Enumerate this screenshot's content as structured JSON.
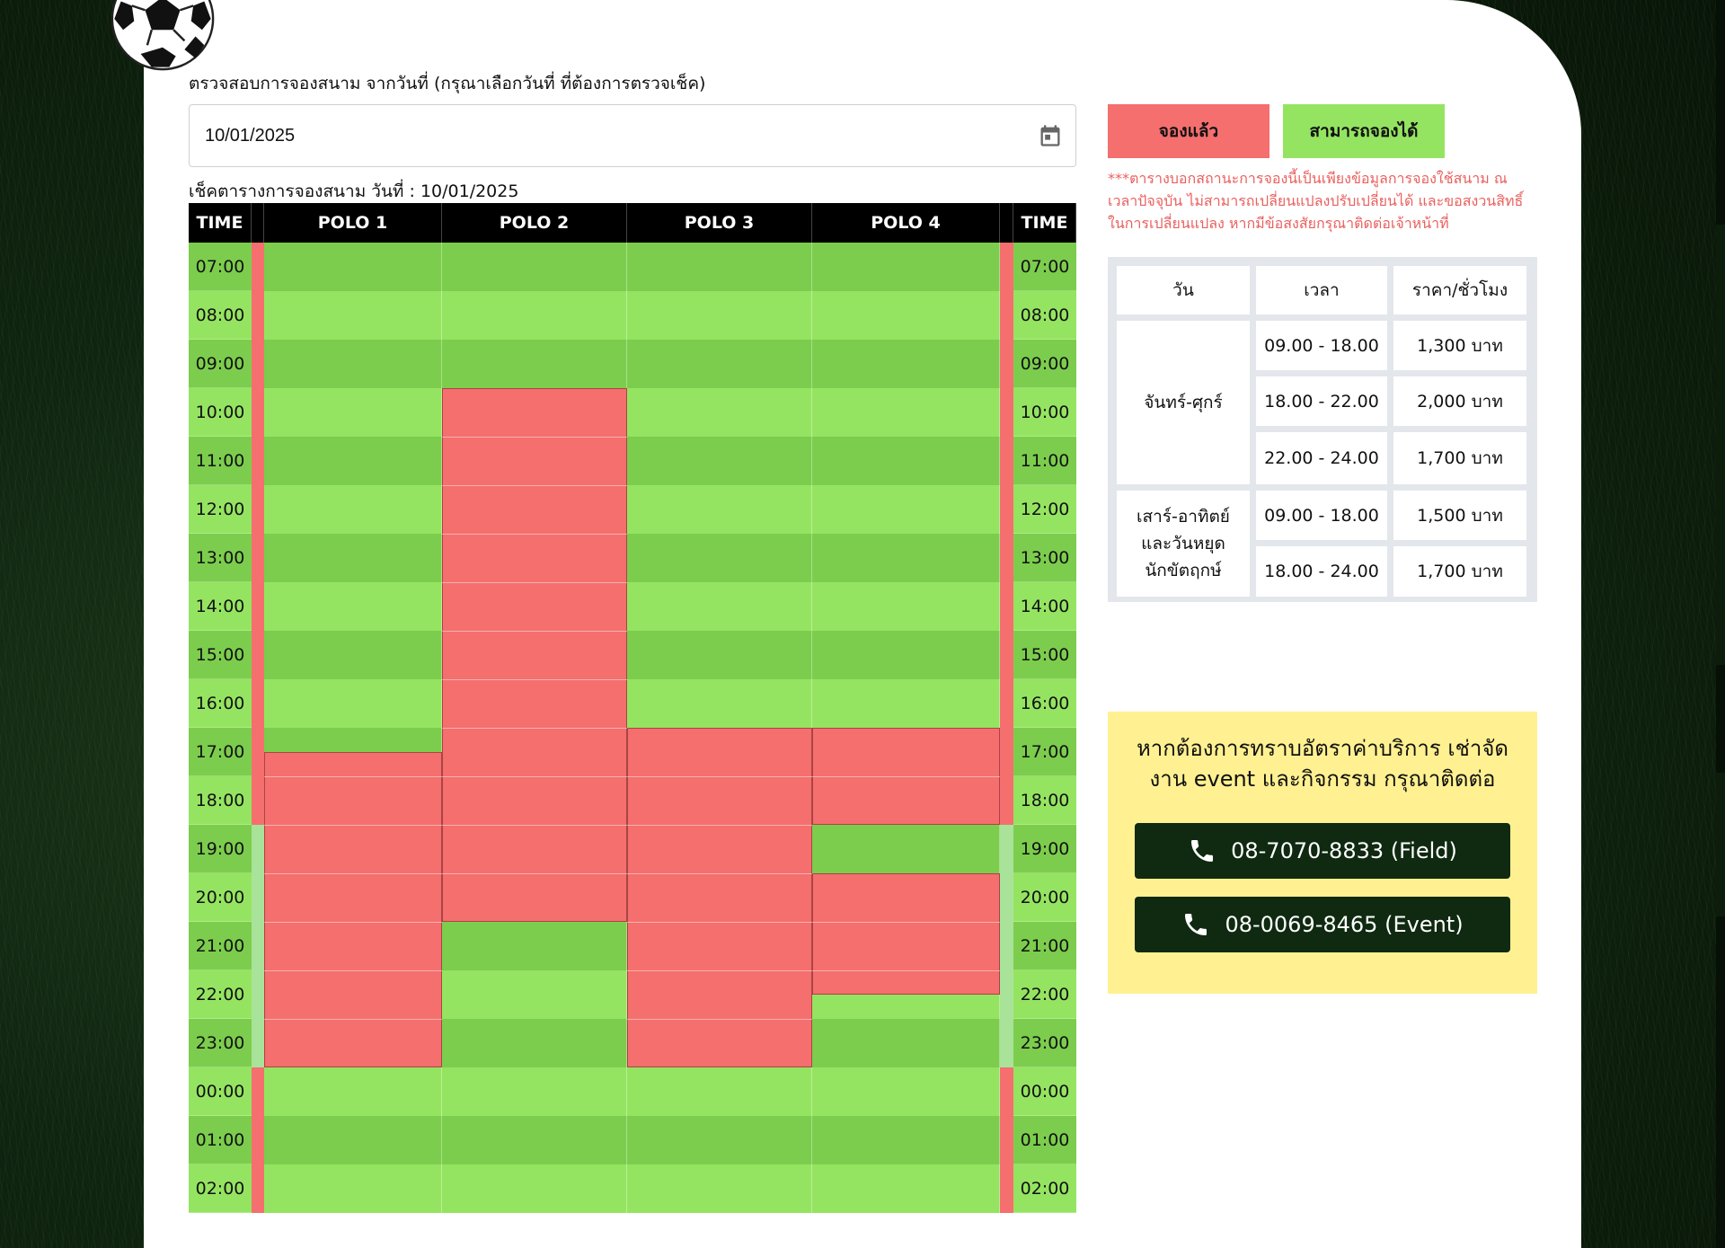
{
  "form": {
    "check_label": "ตรวจสอบการจองสนาม จากวันที่ (กรุณาเลือกวันที่ ที่ต้องการตรวจเช็ค)",
    "date_value": "10/01/2025",
    "calendar_icon": "calendar-icon"
  },
  "schedule": {
    "caption": "เช็คตารางการจองสนาม วันที่ : 10/01/2025",
    "time_header": "TIME",
    "fields": [
      "POLO 1",
      "POLO 2",
      "POLO 3",
      "POLO 4"
    ],
    "hours": [
      "07:00",
      "08:00",
      "09:00",
      "10:00",
      "11:00",
      "12:00",
      "13:00",
      "14:00",
      "15:00",
      "16:00",
      "17:00",
      "18:00",
      "19:00",
      "20:00",
      "21:00",
      "22:00",
      "23:00",
      "00:00",
      "01:00",
      "02:00"
    ],
    "booked": {
      "POLO 1": [
        [
          "17:30",
          "24:00"
        ]
      ],
      "POLO 2": [
        [
          "10:00",
          "21:00"
        ]
      ],
      "POLO 3": [
        [
          "17:00",
          "24:00"
        ]
      ],
      "POLO 4": [
        [
          "17:00",
          "19:00"
        ],
        [
          "20:00",
          "22:30"
        ]
      ]
    },
    "colors": {
      "booked": "#f46f6e",
      "available_dark": "#7ccd4d",
      "available_light": "#95e461"
    }
  },
  "legend": {
    "booked_label": "จองแล้ว",
    "available_label": "สามารถจองได้",
    "note": "***ตารางบอกสถานะการจองนี้เป็นเพียงข้อมูลการจองใช้สนาม ณ เวลาปัจจุบัน ไม่สามารถเปลี่ยนแปลงปรับเปลี่ยนได้ และขอสงวนสิทธิ์ในการเปลี่ยนแปลง หากมีข้อสงสัยกรุณาติดต่อเจ้าหน้าที่"
  },
  "prices": {
    "headers": [
      "วัน",
      "เวลา",
      "ราคา/ชั่วโมง"
    ],
    "weekday_label": "จันทร์-ศุกร์",
    "weekend_label": "เสาร์-อาทิตย์ และวันหยุดนักขัตฤกษ์",
    "weekday_rows": [
      {
        "time": "09.00 - 18.00",
        "price": "1,300 บาท"
      },
      {
        "time": "18.00 - 22.00",
        "price": "2,000 บาท"
      },
      {
        "time": "22.00 - 24.00",
        "price": "1,700 บาท"
      }
    ],
    "weekend_rows": [
      {
        "time": "09.00 - 18.00",
        "price": "1,500 บาท"
      },
      {
        "time": "18.00 - 24.00",
        "price": "1,700 บาท"
      }
    ]
  },
  "contact": {
    "message": "หากต้องการทราบอัตราค่าบริการ เช่าจัดงาน event และกิจกรรม กรุณาติดต่อ",
    "field_phone": "08-7070-8833 (Field)",
    "event_phone": "08-0069-8465 (Event)",
    "phone_icon": "phone-icon"
  }
}
